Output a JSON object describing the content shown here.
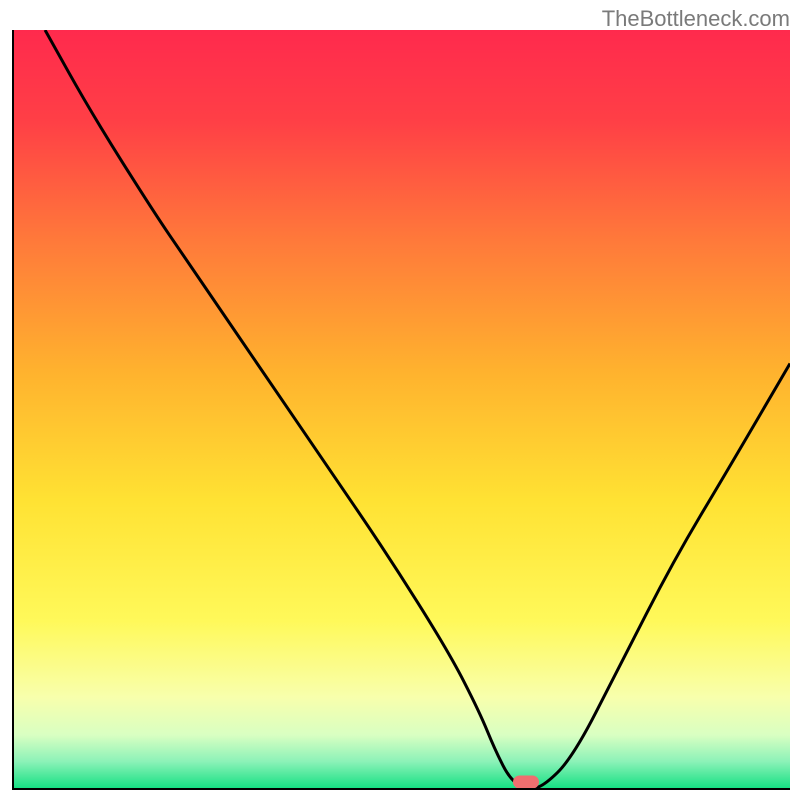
{
  "watermark": "TheBottleneck.com",
  "chart_data": {
    "type": "line",
    "title": "",
    "xlabel": "",
    "ylabel": "",
    "xlim": [
      0,
      100
    ],
    "ylim": [
      0,
      100
    ],
    "grid": false,
    "legend": false,
    "background_gradient": {
      "stops": [
        {
          "offset": 0.0,
          "color": "#ff2a4d"
        },
        {
          "offset": 0.12,
          "color": "#ff3f46"
        },
        {
          "offset": 0.28,
          "color": "#ff7a3a"
        },
        {
          "offset": 0.45,
          "color": "#ffb22e"
        },
        {
          "offset": 0.62,
          "color": "#ffe233"
        },
        {
          "offset": 0.78,
          "color": "#fff95a"
        },
        {
          "offset": 0.88,
          "color": "#f8ffac"
        },
        {
          "offset": 0.93,
          "color": "#d9ffc2"
        },
        {
          "offset": 0.965,
          "color": "#8cf2b8"
        },
        {
          "offset": 1.0,
          "color": "#17e084"
        }
      ]
    },
    "series": [
      {
        "name": "bottleneck-curve",
        "color": "#000000",
        "x": [
          4,
          10,
          18,
          22,
          26,
          32,
          40,
          48,
          56,
          60,
          62,
          64,
          66,
          68,
          72,
          78,
          85,
          92,
          100
        ],
        "y": [
          100,
          89,
          76,
          70,
          64,
          55,
          43,
          31,
          18,
          10,
          5,
          1,
          0,
          0,
          4,
          16,
          30,
          42,
          56
        ]
      }
    ],
    "marker": {
      "name": "optimum-marker",
      "x": 66,
      "y": 0.8,
      "color": "#ef6f6f"
    }
  }
}
